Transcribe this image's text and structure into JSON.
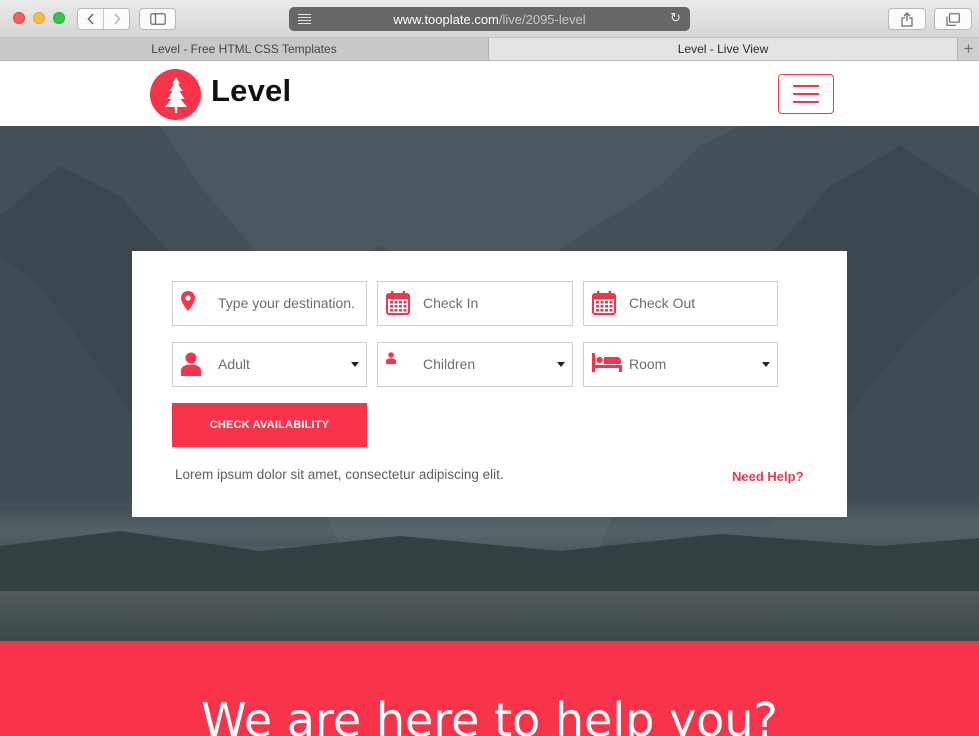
{
  "browser": {
    "url_host": "www.tooplate.com",
    "url_path": "/live/2095-level",
    "tabs": [
      {
        "label": "Level - Free HTML CSS Templates",
        "active": false
      },
      {
        "label": "Level - Live View",
        "active": true
      }
    ]
  },
  "header": {
    "logo_text": "Level",
    "menu_icon": "hamburger-icon"
  },
  "booking": {
    "fields": [
      {
        "label": "Type your destination.",
        "icon": "map-pin-icon",
        "type": "input"
      },
      {
        "label": "Check In",
        "icon": "calendar-icon",
        "type": "input"
      },
      {
        "label": "Check Out",
        "icon": "calendar-icon",
        "type": "input"
      },
      {
        "label": "Adult",
        "icon": "user-icon",
        "type": "select"
      },
      {
        "label": "Children",
        "icon": "child-icon",
        "type": "select"
      },
      {
        "label": "Room",
        "icon": "bed-icon",
        "type": "select"
      }
    ],
    "button_label": "CHECK AVAILABILITY",
    "note": "Lorem ipsum dolor sit amet, consectetur adipiscing elit.",
    "help_link": "Need Help?"
  },
  "help_section": {
    "title": "We are here to help you?"
  },
  "colors": {
    "accent": "#f9334a",
    "hero_overlay": "#4c5660"
  }
}
